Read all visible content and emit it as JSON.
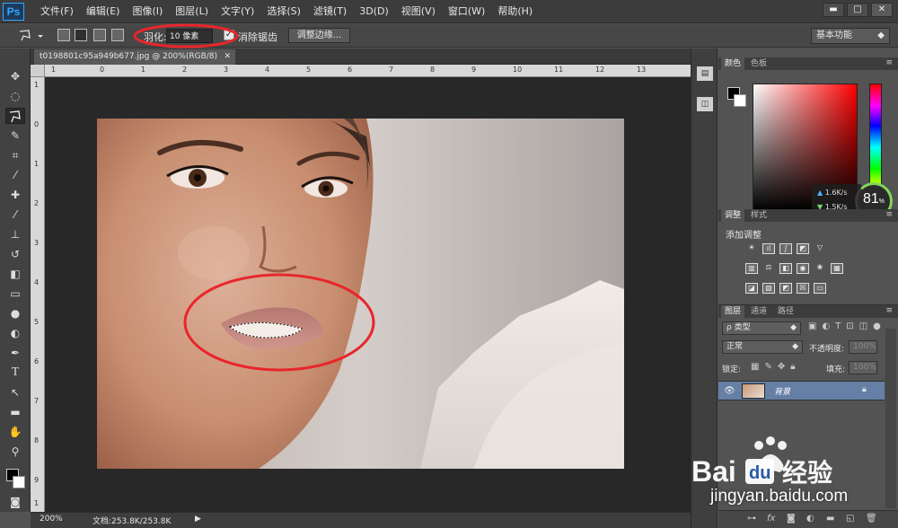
{
  "app": {
    "logo": "Ps"
  },
  "menus": [
    "文件(F)",
    "编辑(E)",
    "图像(I)",
    "图层(L)",
    "文字(Y)",
    "选择(S)",
    "滤镜(T)",
    "3D(D)",
    "视图(V)",
    "窗口(W)",
    "帮助(H)"
  ],
  "window_controls": {
    "minimize": "▬",
    "restore": "□",
    "close": "✕"
  },
  "options": {
    "feather_label": "羽化:",
    "feather_value": "10 像素",
    "antialias_check": "✓",
    "antialias_label": "消除锯齿",
    "refine_edge_label": "调整边缘...",
    "workspace": "基本功能",
    "dropdown_arrow": "◆"
  },
  "document": {
    "tab_title": "t0198801c95a949b677.jpg @ 200%(RGB/8)",
    "tab_close": "✕",
    "ruler_top": [
      "1",
      "0",
      "1",
      "2",
      "3",
      "4",
      "5",
      "6",
      "7",
      "8",
      "9",
      "10",
      "11",
      "12",
      "13"
    ],
    "ruler_left": [
      "1",
      "0",
      "1",
      "2",
      "3",
      "4",
      "5",
      "6",
      "7",
      "8",
      "9",
      "1"
    ]
  },
  "status": {
    "zoom": "200%",
    "doc_size": "文档:253.8K/253.8K",
    "arrow": "▶"
  },
  "color_panel": {
    "tab_color": "颜色",
    "tab_swatches": "色板"
  },
  "network": {
    "up": "1.6",
    "down": "1.5",
    "unit": "K/s",
    "percent": "81",
    "percent_sign": "%"
  },
  "adjustments_panel": {
    "tab_adjust": "调整",
    "tab_styles": "样式",
    "title": "添加调整"
  },
  "layers_panel": {
    "tab_layers": "图层",
    "tab_channels": "通道",
    "tab_paths": "路径",
    "filter_kind": "ρ 类型",
    "blend_mode": "正常",
    "opacity_label": "不透明度:",
    "opacity_value": "100%",
    "lock_label": "锁定:",
    "fill_label": "填充:",
    "fill_value": "100%",
    "layer_name": "背景"
  },
  "watermark": {
    "subtext": "jingyan.baidu.com"
  },
  "annotation": {
    "color": "#e8262b"
  }
}
